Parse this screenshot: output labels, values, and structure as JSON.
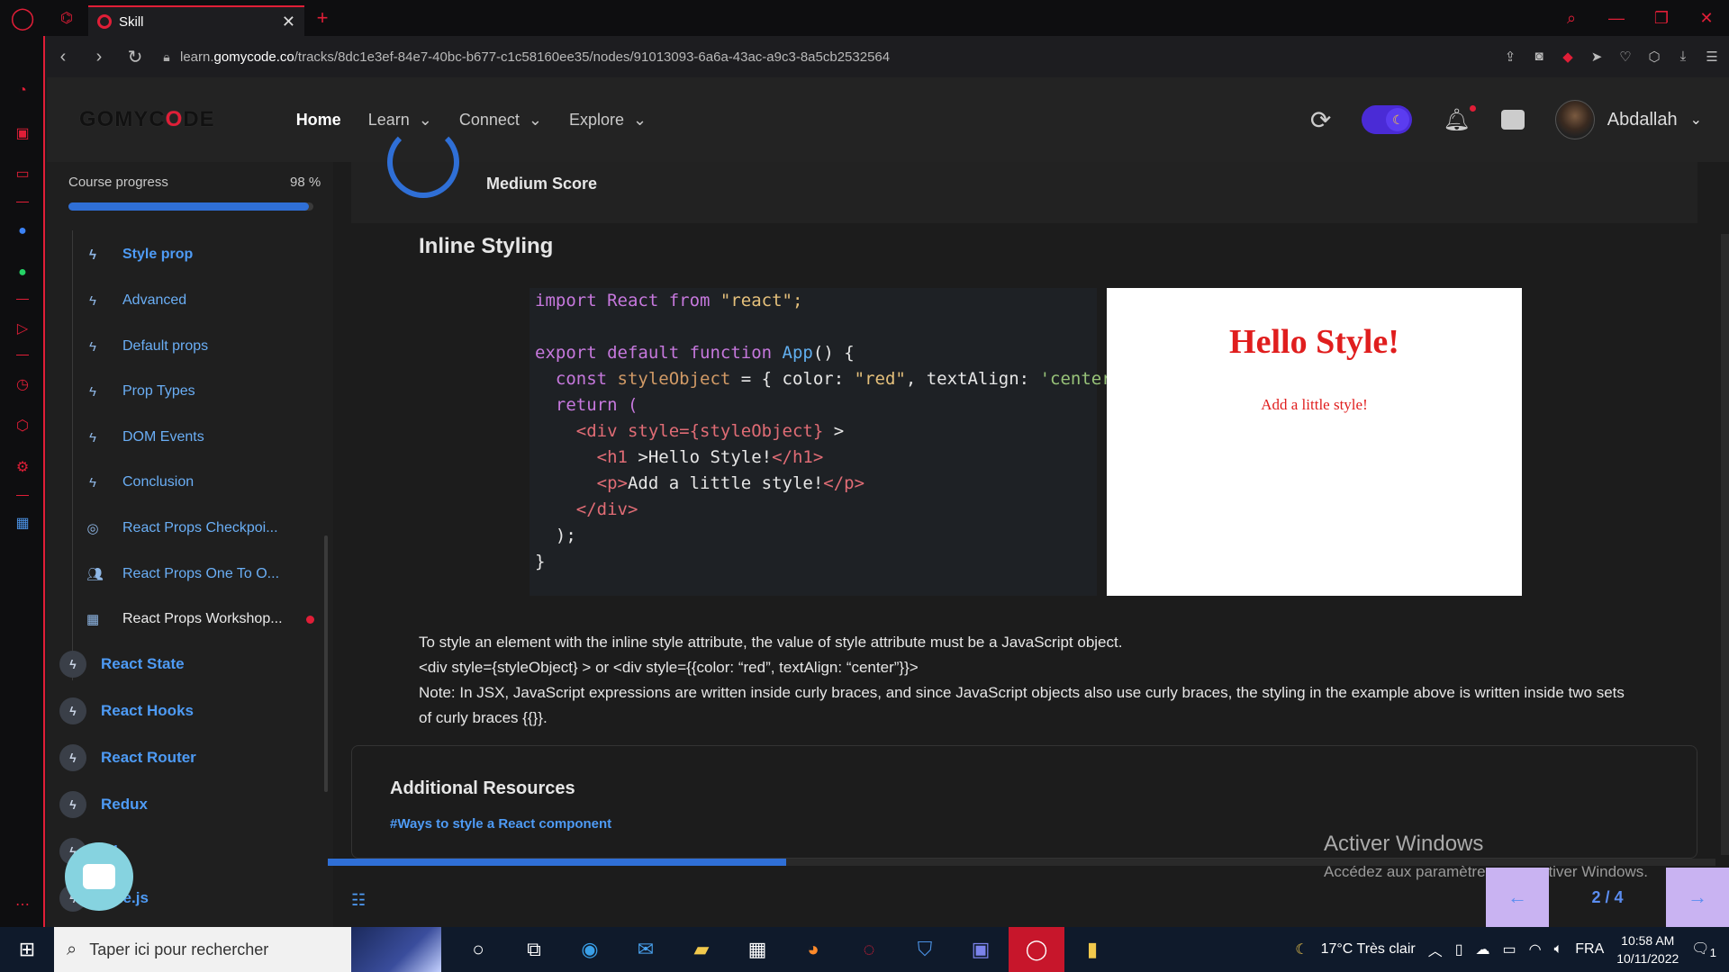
{
  "browser": {
    "tab_title": "Skill",
    "url_prefix": "learn.",
    "url_domain": "gomycode.co",
    "url_path": "/tracks/8dc1e3ef-84e7-40bc-b677-c1c58160ee35/nodes/91013093-6a6a-43ac-a9c3-8a5cb2532564"
  },
  "header": {
    "logo_pre": "GOMYC",
    "logo_o": "O",
    "logo_post": "DE",
    "nav": [
      {
        "label": "Home"
      },
      {
        "label": "Learn"
      },
      {
        "label": "Connect"
      },
      {
        "label": "Explore"
      }
    ],
    "username": "Abdallah"
  },
  "sidebar": {
    "progress_label": "Course progress",
    "progress_pct": "98 %",
    "progress_value": 0.98,
    "items": [
      {
        "label": "Style prop",
        "icon": "bolt-icon"
      },
      {
        "label": "Advanced",
        "icon": "bolt-icon"
      },
      {
        "label": "Default props",
        "icon": "bolt-icon"
      },
      {
        "label": "Prop Types",
        "icon": "bolt-icon"
      },
      {
        "label": "DOM Events",
        "icon": "bolt-icon"
      },
      {
        "label": "Conclusion",
        "icon": "bolt-icon"
      },
      {
        "label": "React Props Checkpoi...",
        "icon": "target-icon"
      },
      {
        "label": "React Props One To O...",
        "icon": "people-icon"
      },
      {
        "label": "React Props Workshop...",
        "icon": "workshop-icon"
      }
    ],
    "chapters": [
      {
        "label": "React State"
      },
      {
        "label": "React Hooks"
      },
      {
        "label": "React Router"
      },
      {
        "label": "Redux"
      },
      {
        "label": "...l"
      },
      {
        "label": "...de.js"
      }
    ]
  },
  "content": {
    "score_label": "Medium Score",
    "section_title": "Inline Styling",
    "code": {
      "l1_import": "import",
      "l1_react": " React ",
      "l1_from": "from",
      "l1_str": " \"react\";",
      "l3_export": "export default function ",
      "l3_fn": "App",
      "l3_rest": "() {",
      "l4_const": "  const ",
      "l4_var": "styleObject",
      "l4_mid": " = { color: ",
      "l4_red": "\"red\"",
      "l4_mid2": ", textAlign: ",
      "l4_center": "'center'",
      "l4_end": "}",
      "l5": "  return (",
      "l6_open": "    <div ",
      "l6_attr": "style={styleObject}",
      "l6_end": " >",
      "l7_open": "      <h1 ",
      "l7_txt": ">Hello Style!",
      "l7_close": "</h1>",
      "l8_open": "      <p>",
      "l8_txt": "Add a little style!",
      "l8_close": "</p>",
      "l9": "    </div>",
      "l10": "  );",
      "l11": "}"
    },
    "preview_h1": "Hello Style!",
    "preview_p": "Add a little style!",
    "desc_lines": [
      "To style an element with the inline style attribute, the value of style attribute must be a JavaScript object.",
      "<div style={styleObject} > or <div style={{color: “red”, textAlign: “center”}}>",
      "Note: In JSX, JavaScript expressions are written inside curly braces, and since JavaScript objects also use curly braces, the styling in the example above is written inside two sets of curly braces {{}}."
    ],
    "resources_title": "Additional Resources",
    "resources_link": "#Ways to style a React component",
    "lesson_progress": 0.33,
    "pager": "2 / 4"
  },
  "watermark": {
    "title": "Activer Windows",
    "sub": "Accédez aux paramètres pour activer Windows."
  },
  "taskbar": {
    "search_placeholder": "Taper ici pour rechercher",
    "weather": "17°C  Très clair",
    "lang": "FRA",
    "time": "10:58 AM",
    "date": "10/11/2022",
    "notif_count": "1"
  },
  "colors": {
    "accent": "#e01e37",
    "link": "#4e9bf5",
    "progress": "#2f6fd6"
  }
}
